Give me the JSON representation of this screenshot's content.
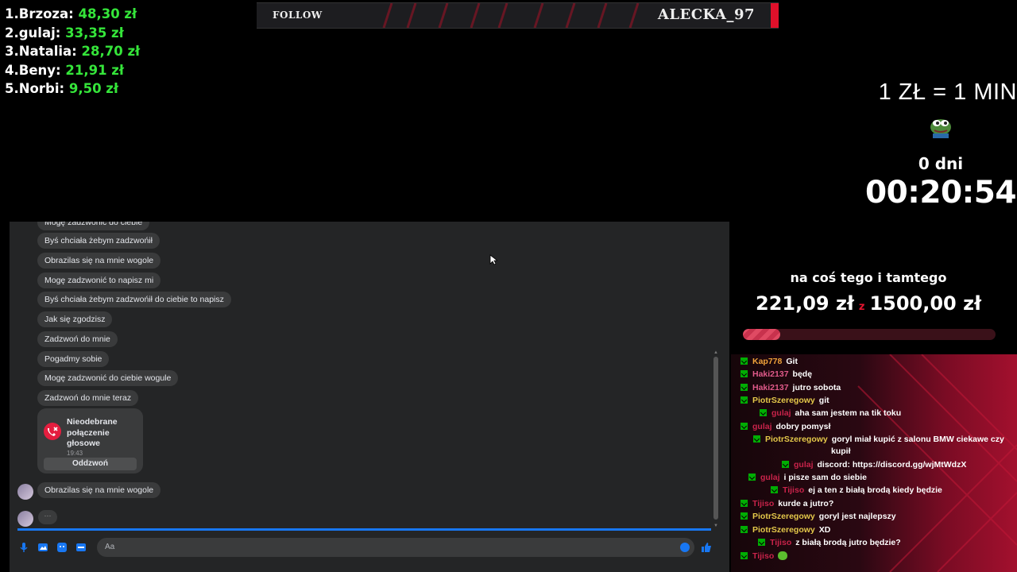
{
  "leaderboard": [
    {
      "label": "1.Brzoza: ",
      "amount": "48,30 zł"
    },
    {
      "label": "2.gulaj: ",
      "amount": "33,35 zł"
    },
    {
      "label": "3.Natalia: ",
      "amount": "28,70 zł"
    },
    {
      "label": "4.Beny: ",
      "amount": "21,91 zł"
    },
    {
      "label": "5.Norbi: ",
      "amount": "9,50 zł"
    }
  ],
  "follow_banner": {
    "label": "FOLLOW",
    "name": "ALECKA_97",
    "accent_color": "#e0102a"
  },
  "timer": {
    "rate": "1 ZŁ = 1 MIN",
    "days": "0 dni",
    "time": "00:20:54",
    "emote": "pepe-frog-icon"
  },
  "goal": {
    "title": "na coś tego i tamtego",
    "current": "221,09 zł",
    "separator": "z",
    "target": "1500,00 zł",
    "progress": 0.147
  },
  "chat": [
    {
      "user": "Kap778",
      "color": "#f0a23a",
      "msg": "Git"
    },
    {
      "user": "Haki2137",
      "color": "#e05a8a",
      "msg": "będę"
    },
    {
      "user": "Haki2137",
      "color": "#e05a8a",
      "msg": "jutro sobota"
    },
    {
      "user": "PiotrSzeregowy",
      "color": "#e4c84a",
      "msg": "git"
    },
    {
      "user": "gulaj",
      "color": "#c8234a",
      "msg": "aha sam jestem na tik toku"
    },
    {
      "user": "gulaj",
      "color": "#c8234a",
      "msg": "dobry pomysł"
    },
    {
      "user": "PiotrSzeregowy",
      "color": "#e4c84a",
      "msg": "goryl miał kupić z salonu BMW ciekawe czy"
    },
    {
      "user": "",
      "color": "#ffffff",
      "msg": "kupił"
    },
    {
      "user": "gulaj",
      "color": "#c8234a",
      "msg": "discord: https://discord.gg/wjMtWdzX"
    },
    {
      "user": "gulaj",
      "color": "#c8234a",
      "msg": "i pisze sam do siebie"
    },
    {
      "user": "Tijiso",
      "color": "#c8234a",
      "msg": "ej a ten z białą brodą kiedy będzie"
    },
    {
      "user": "Tijiso",
      "color": "#c8234a",
      "msg": "kurde a jutro?"
    },
    {
      "user": "PiotrSzeregowy",
      "color": "#e4c84a",
      "msg": "goryl jest najlepszy"
    },
    {
      "user": "PiotrSzeregowy",
      "color": "#e4c84a",
      "msg": "XD"
    },
    {
      "user": "Tijiso",
      "color": "#c8234a",
      "msg": "z białą brodą jutro będzie?"
    },
    {
      "user": "Tijiso",
      "color": "#c8234a",
      "msg": "",
      "emote": "green-emote-icon"
    }
  ],
  "messenger": {
    "messages": [
      "Mogę zadzwonić do ciebie",
      "Byś chciała żebym zadzwońił",
      "Obrazilas się na mnie wogole",
      "Mogę zadzwonić to napisz mi",
      "Byś chciała żebym zadzwońił do ciebie to napisz",
      "Jak się zgodzisz",
      "Zadzwoń do mnie",
      "Pogadmy sobie",
      "Mogę zadzwonić do ciebie wogule",
      "Zadzwoń do mnie teraz"
    ],
    "missed_call": {
      "title": "Nieodebrane połączenie głosowe",
      "time": "19:43",
      "button": "Oddzwoń"
    },
    "last_message": "Obrazilas się na mnie wogole",
    "typing": "···",
    "composer_placeholder": "Aa"
  }
}
